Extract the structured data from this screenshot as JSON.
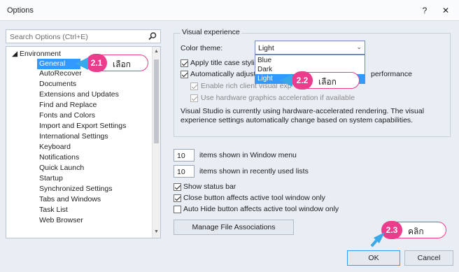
{
  "window": {
    "title": "Options",
    "help_glyph": "?",
    "close_glyph": "✕"
  },
  "search": {
    "placeholder": "Search Options (Ctrl+E)"
  },
  "tree": {
    "root": "◢ Environment",
    "items": [
      "General",
      "AutoRecover",
      "Documents",
      "Extensions and Updates",
      "Find and Replace",
      "Fonts and Colors",
      "Import and Export Settings",
      "International Settings",
      "Keyboard",
      "Notifications",
      "Quick Launch",
      "Startup",
      "Synchronized Settings",
      "Tabs and Windows",
      "Task List",
      "Web Browser"
    ],
    "selected": "General"
  },
  "visual_experience": {
    "group_label": "Visual experience",
    "color_theme_label": "Color theme:",
    "color_theme_value": "Light",
    "theme_options": [
      "Blue",
      "Dark",
      "Light"
    ],
    "apply_title_case": "Apply title case styling",
    "auto_adjust": "Automatically adjust visual experience based on client performance",
    "auto_adjust_left": "Automatically adjust",
    "auto_adjust_right": "performance",
    "rich_client": "Enable rich client visual experience",
    "hardware_accel": "Use hardware graphics acceleration if available",
    "info_text": "Visual Studio is currently using hardware-accelerated rendering. The visual experience settings automatically change based on system capabilities."
  },
  "window_menu": {
    "value": "10",
    "label": "items shown in Window menu"
  },
  "recent_lists": {
    "value": "10",
    "label": "items shown in recently used lists"
  },
  "options": {
    "show_status_bar": "Show status bar",
    "close_button": "Close button affects active tool window only",
    "auto_hide": "Auto Hide button affects active tool window only"
  },
  "buttons": {
    "manage_file_assoc": "Manage File Associations",
    "ok": "OK",
    "cancel": "Cancel"
  },
  "callouts": [
    {
      "badge": "2.1",
      "text": "เลือก"
    },
    {
      "badge": "2.2",
      "text": "เลือก"
    },
    {
      "badge": "2.3",
      "text": "คลิก"
    }
  ],
  "colors": {
    "callout": "#ec3c8c",
    "pointer": "#3aa7e6",
    "selection": "#3399ff"
  }
}
